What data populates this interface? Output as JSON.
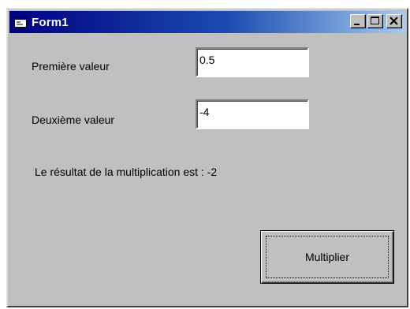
{
  "window": {
    "title": "Form1",
    "icon": "form-app-icon",
    "controls": {
      "minimize_icon": "minimize-icon",
      "maximize_icon": "maximize-icon",
      "close_icon": "close-icon"
    }
  },
  "form": {
    "first_label": "Première valeur",
    "first_value": "0.5",
    "second_label": "Deuxième valeur",
    "second_value": "-4",
    "result_text": "Le résultat de la multiplication est : -2",
    "button_label": "Multiplier"
  },
  "colors": {
    "title_bar_start": "#000080",
    "title_bar_end": "#a6caf0",
    "face": "#c0c0c0"
  }
}
